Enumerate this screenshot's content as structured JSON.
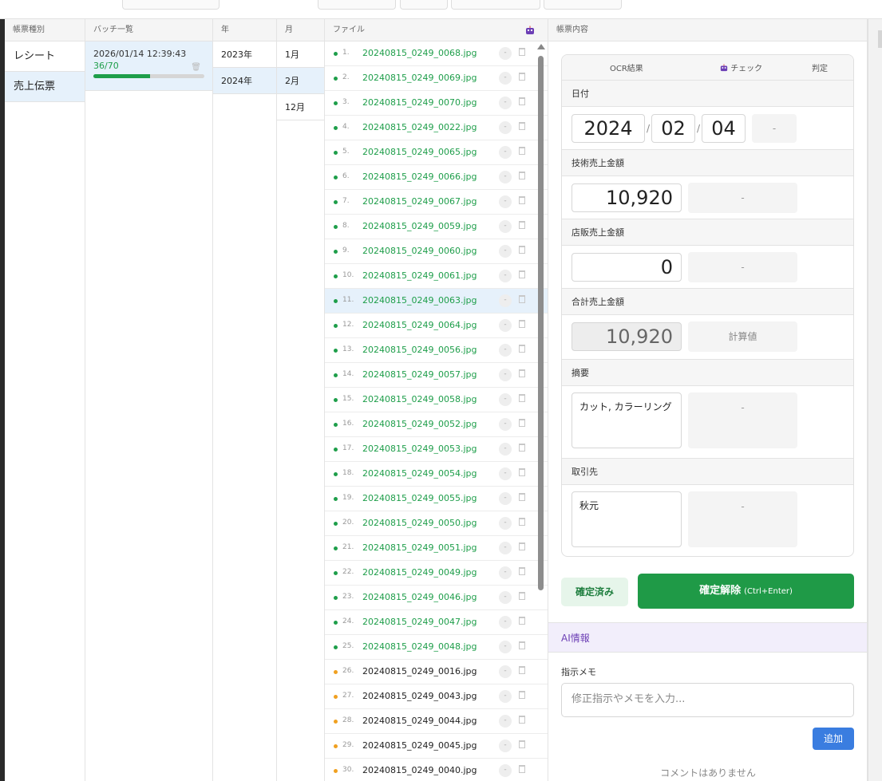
{
  "columns": {
    "type_header": "帳票種別",
    "batch_header": "バッチ一覧",
    "year_header": "年",
    "month_header": "月",
    "file_header": "ファイル",
    "detail_header": "帳票内容"
  },
  "types": [
    {
      "label": "レシート",
      "selected": false
    },
    {
      "label": "売上伝票",
      "selected": true
    }
  ],
  "batch": {
    "datetime": "2026/01/14 12:39:43",
    "count": "36/70",
    "progress": 0.514
  },
  "years": [
    {
      "label": "2023年",
      "selected": false
    },
    {
      "label": "2024年",
      "selected": true
    }
  ],
  "months": [
    {
      "label": "1月",
      "selected": false
    },
    {
      "label": "2月",
      "selected": true
    },
    {
      "label": "12月",
      "selected": false
    }
  ],
  "files": [
    {
      "num": "1.",
      "name": "20240815_0249_0068.jpg",
      "status": "done"
    },
    {
      "num": "2.",
      "name": "20240815_0249_0069.jpg",
      "status": "done"
    },
    {
      "num": "3.",
      "name": "20240815_0249_0070.jpg",
      "status": "done"
    },
    {
      "num": "4.",
      "name": "20240815_0249_0022.jpg",
      "status": "done"
    },
    {
      "num": "5.",
      "name": "20240815_0249_0065.jpg",
      "status": "done"
    },
    {
      "num": "6.",
      "name": "20240815_0249_0066.jpg",
      "status": "done"
    },
    {
      "num": "7.",
      "name": "20240815_0249_0067.jpg",
      "status": "done"
    },
    {
      "num": "8.",
      "name": "20240815_0249_0059.jpg",
      "status": "done"
    },
    {
      "num": "9.",
      "name": "20240815_0249_0060.jpg",
      "status": "done"
    },
    {
      "num": "10.",
      "name": "20240815_0249_0061.jpg",
      "status": "done"
    },
    {
      "num": "11.",
      "name": "20240815_0249_0063.jpg",
      "status": "done",
      "selected": true
    },
    {
      "num": "12.",
      "name": "20240815_0249_0064.jpg",
      "status": "done"
    },
    {
      "num": "13.",
      "name": "20240815_0249_0056.jpg",
      "status": "done"
    },
    {
      "num": "14.",
      "name": "20240815_0249_0057.jpg",
      "status": "done"
    },
    {
      "num": "15.",
      "name": "20240815_0249_0058.jpg",
      "status": "done"
    },
    {
      "num": "16.",
      "name": "20240815_0249_0052.jpg",
      "status": "done"
    },
    {
      "num": "17.",
      "name": "20240815_0249_0053.jpg",
      "status": "done"
    },
    {
      "num": "18.",
      "name": "20240815_0249_0054.jpg",
      "status": "done"
    },
    {
      "num": "19.",
      "name": "20240815_0249_0055.jpg",
      "status": "done"
    },
    {
      "num": "20.",
      "name": "20240815_0249_0050.jpg",
      "status": "done"
    },
    {
      "num": "21.",
      "name": "20240815_0249_0051.jpg",
      "status": "done"
    },
    {
      "num": "22.",
      "name": "20240815_0249_0049.jpg",
      "status": "done"
    },
    {
      "num": "23.",
      "name": "20240815_0249_0046.jpg",
      "status": "done"
    },
    {
      "num": "24.",
      "name": "20240815_0249_0047.jpg",
      "status": "done"
    },
    {
      "num": "25.",
      "name": "20240815_0249_0048.jpg",
      "status": "done"
    },
    {
      "num": "26.",
      "name": "20240815_0249_0016.jpg",
      "status": "pending"
    },
    {
      "num": "27.",
      "name": "20240815_0249_0043.jpg",
      "status": "pending"
    },
    {
      "num": "28.",
      "name": "20240815_0249_0044.jpg",
      "status": "pending"
    },
    {
      "num": "29.",
      "name": "20240815_0249_0045.jpg",
      "status": "pending"
    },
    {
      "num": "30.",
      "name": "20240815_0249_0040.jpg",
      "status": "pending"
    }
  ],
  "file_dash": "-",
  "colors": {
    "done": "#1e9e4a",
    "pending": "#f0a020",
    "accent": "#1f9a47",
    "ai": "#6c3fb5",
    "add_button": "#3a7de0"
  },
  "detail": {
    "head_ocr": "OCR結果",
    "head_check": "チェック",
    "head_judge": "判定",
    "date_label": "日付",
    "date_year": "2024",
    "date_month": "02",
    "date_day": "04",
    "date_sep": "/",
    "date_judge": "-",
    "tech_label": "技術売上金額",
    "tech_value": "10,920",
    "tech_judge": "-",
    "shop_label": "店販売上金額",
    "shop_value": "0",
    "shop_judge": "-",
    "total_label": "合計売上金額",
    "total_value": "10,920",
    "total_judge": "計算値",
    "summary_label": "摘要",
    "summary_value": "カット, カラーリング",
    "summary_judge": "-",
    "partner_label": "取引先",
    "partner_value": "秋元",
    "partner_judge": "-"
  },
  "actions": {
    "confirmed": "確定済み",
    "unconfirm": "確定解除",
    "unconfirm_shortcut": "(Ctrl+Enter)"
  },
  "ai": {
    "header": "AI情報",
    "memo_label": "指示メモ",
    "memo_placeholder": "修正指示やメモを入力...",
    "add": "追加",
    "no_comments": "コメントはありません"
  }
}
